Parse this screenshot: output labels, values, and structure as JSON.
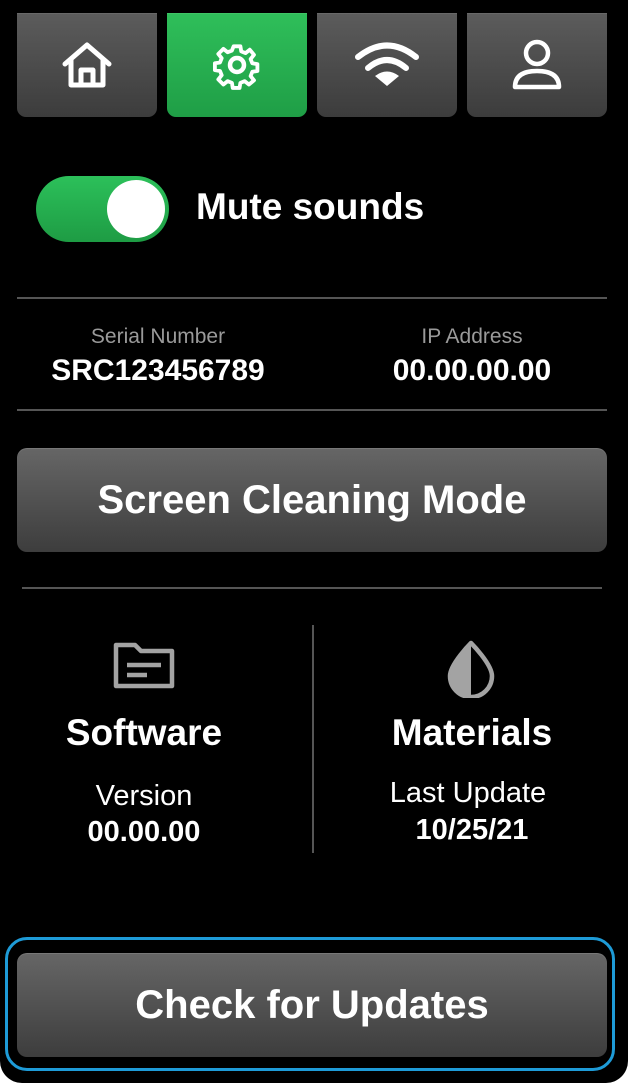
{
  "tabs": [
    {
      "icon": "home-icon",
      "active": false
    },
    {
      "icon": "gear-icon",
      "active": true
    },
    {
      "icon": "wifi-icon",
      "active": false
    },
    {
      "icon": "user-icon",
      "active": false
    }
  ],
  "mute": {
    "label": "Mute sounds",
    "enabled": true
  },
  "device": {
    "serial_label": "Serial Number",
    "serial_value": "SRC123456789",
    "ip_label": "IP Address",
    "ip_value": "00.00.00.00"
  },
  "screen_cleaning_label": "Screen Cleaning Mode",
  "software": {
    "icon": "folder-icon",
    "title": "Software",
    "sub_label": "Version",
    "value": "00.00.00"
  },
  "materials": {
    "icon": "drop-icon",
    "title": "Materials",
    "sub_label": "Last Update",
    "value": "10/25/21"
  },
  "check_updates_label": "Check for Updates",
  "colors": {
    "accent": "#2cc05a",
    "focus": "#1e9bd7",
    "button": "#555555"
  }
}
